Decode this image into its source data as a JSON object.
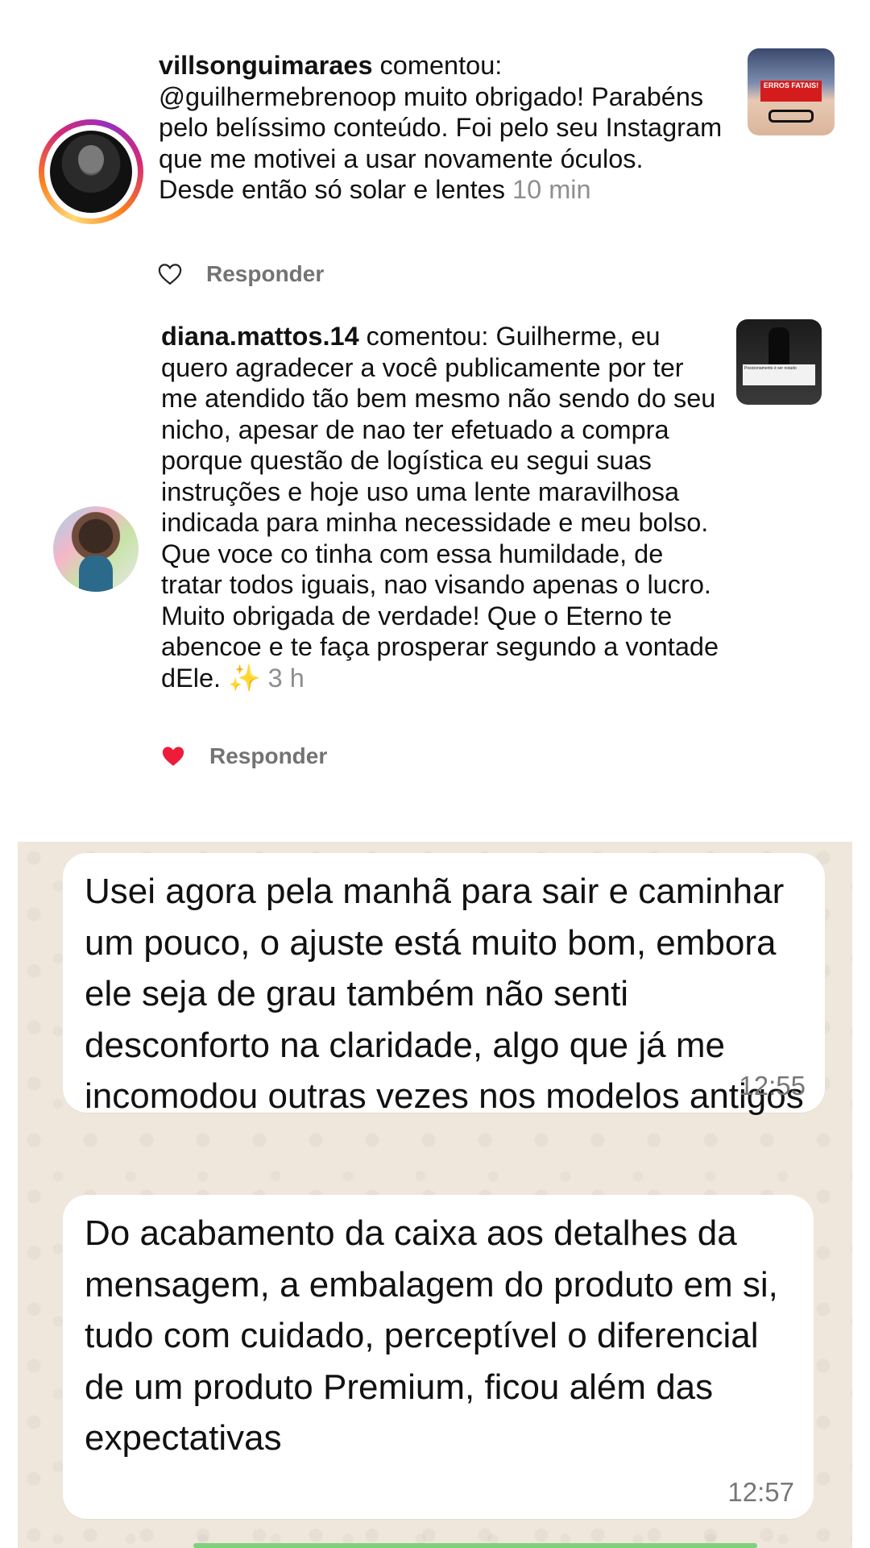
{
  "comments": [
    {
      "username": "villsonguimaraes",
      "text": " comentou: @guilhermebrenoop muito obrigado! Parabéns pelo belíssimo conteúdo. Foi pelo seu Instagram que me motivei a usar novamente óculos. Desde então só solar e lentes",
      "time": "10 min",
      "reply_label": "Responder",
      "liked": false,
      "thumbnail_text": "ERROS FATAIS!"
    },
    {
      "username": "diana.mattos.14",
      "text": " comentou: Guilherme, eu quero agradecer a você publicamente por ter me atendido tão bem mesmo não sendo do seu nicho, apesar de nao ter efetuado a compra porque questão de logística eu segui suas instruções e hoje uso uma lente maravilhosa indicada para minha necessidade e meu bolso. Que voce co tinha com essa humildade, de tratar todos iguais, nao visando apenas o lucro. Muito obrigada de verdade! Que o Eterno te abencoe e te faça prosperar segundo a vontade dEle. ✨",
      "time": "3 h",
      "reply_label": "Responder",
      "liked": true,
      "thumbnail_text": "Posicionamento é ser notado"
    }
  ],
  "messages": [
    {
      "text": "Usei agora pela manhã para sair e caminhar um pouco, o ajuste está muito bom, embora ele seja de grau também não senti desconforto na claridade, algo que já me incomodou outras vezes nos modelos antigos",
      "time": "12:55"
    },
    {
      "text": "Do acabamento da caixa aos detalhes da mensagem, a embalagem do produto em si, tudo com cuidado, perceptível o diferencial de um produto Premium, ficou além das expectativas",
      "time": "12:57"
    }
  ],
  "colors": {
    "heart_liked": "#ed1c3a",
    "time_gray": "#8e8e8e",
    "chat_background": "#efe7dc",
    "bubble": "#ffffff"
  }
}
